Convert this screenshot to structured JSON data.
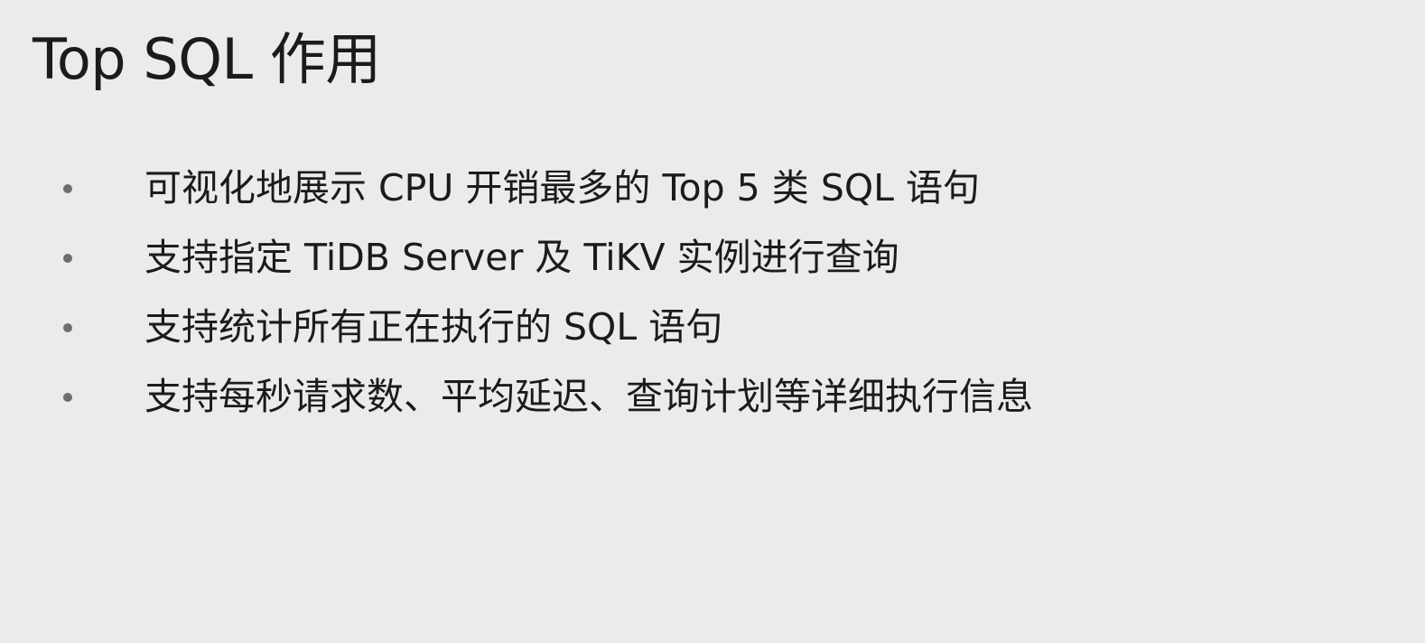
{
  "slide": {
    "title": "Top SQL 作用",
    "bullets": [
      "可视化地展示 CPU 开销最多的 Top 5 类 SQL 语句",
      "支持指定 TiDB Server 及 TiKV 实例进行查询",
      "支持统计所有正在执行的 SQL 语句",
      "支持每秒请求数、平均延迟、查询计划等详细执行信息"
    ]
  }
}
